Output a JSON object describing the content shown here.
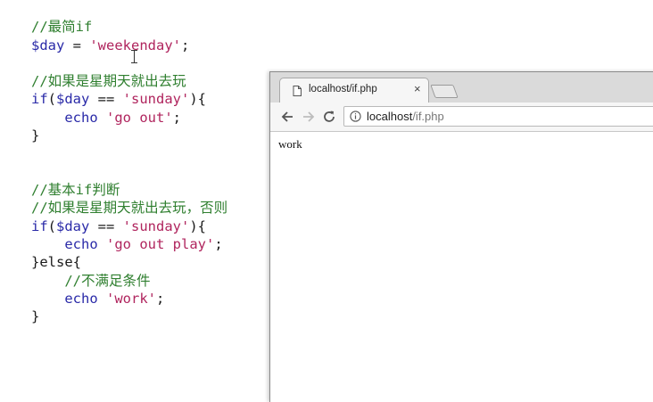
{
  "code": {
    "lines": [
      [
        {
          "t": "//最简if",
          "c": "cmt"
        }
      ],
      [
        {
          "t": "$day",
          "c": "var"
        },
        {
          "t": " = ",
          "c": "pn"
        },
        {
          "t": "'weekenday'",
          "c": "str"
        },
        {
          "t": ";",
          "c": "pn"
        }
      ],
      [],
      [
        {
          "t": "//如果是星期天就出去玩",
          "c": "cmt"
        }
      ],
      [
        {
          "t": "if",
          "c": "kw"
        },
        {
          "t": "(",
          "c": "pn"
        },
        {
          "t": "$day",
          "c": "var"
        },
        {
          "t": " == ",
          "c": "pn"
        },
        {
          "t": "'sunday'",
          "c": "str"
        },
        {
          "t": "){",
          "c": "pn"
        }
      ],
      [
        {
          "t": "    echo ",
          "c": "kw"
        },
        {
          "t": "'go out'",
          "c": "str"
        },
        {
          "t": ";",
          "c": "pn"
        }
      ],
      [
        {
          "t": "}",
          "c": "pn"
        }
      ],
      [],
      [],
      [
        {
          "t": "//基本if判断",
          "c": "cmt"
        }
      ],
      [
        {
          "t": "//如果是星期天就出去玩，否则",
          "c": "cmt"
        }
      ],
      [
        {
          "t": "if",
          "c": "kw"
        },
        {
          "t": "(",
          "c": "pn"
        },
        {
          "t": "$day",
          "c": "var"
        },
        {
          "t": " == ",
          "c": "pn"
        },
        {
          "t": "'sunday'",
          "c": "str"
        },
        {
          "t": "){",
          "c": "pn"
        }
      ],
      [
        {
          "t": "    echo ",
          "c": "kw"
        },
        {
          "t": "'go out play'",
          "c": "str"
        },
        {
          "t": ";",
          "c": "pn"
        }
      ],
      [
        {
          "t": "}else{",
          "c": "pn"
        }
      ],
      [
        {
          "t": "    //不满足条件",
          "c": "cmt"
        }
      ],
      [
        {
          "t": "    echo ",
          "c": "kw"
        },
        {
          "t": "'work'",
          "c": "str"
        },
        {
          "t": ";",
          "c": "pn"
        }
      ],
      [
        {
          "t": "}",
          "c": "pn"
        }
      ]
    ]
  },
  "browser": {
    "tab": {
      "title": "localhost/if.php",
      "close_label": "×",
      "icon": "page-icon"
    },
    "new_tab_icon": "new-tab-icon",
    "toolbar": {
      "back_icon": "arrow-left-icon",
      "forward_icon": "arrow-right-icon",
      "reload_icon": "reload-icon",
      "info_icon": "info-icon"
    },
    "address": {
      "host": "localhost",
      "path": "/if.php"
    },
    "page_output": "work"
  },
  "colors": {
    "comment": "#2f7f2f",
    "keyword": "#2a2aa8",
    "string": "#b0255e"
  }
}
